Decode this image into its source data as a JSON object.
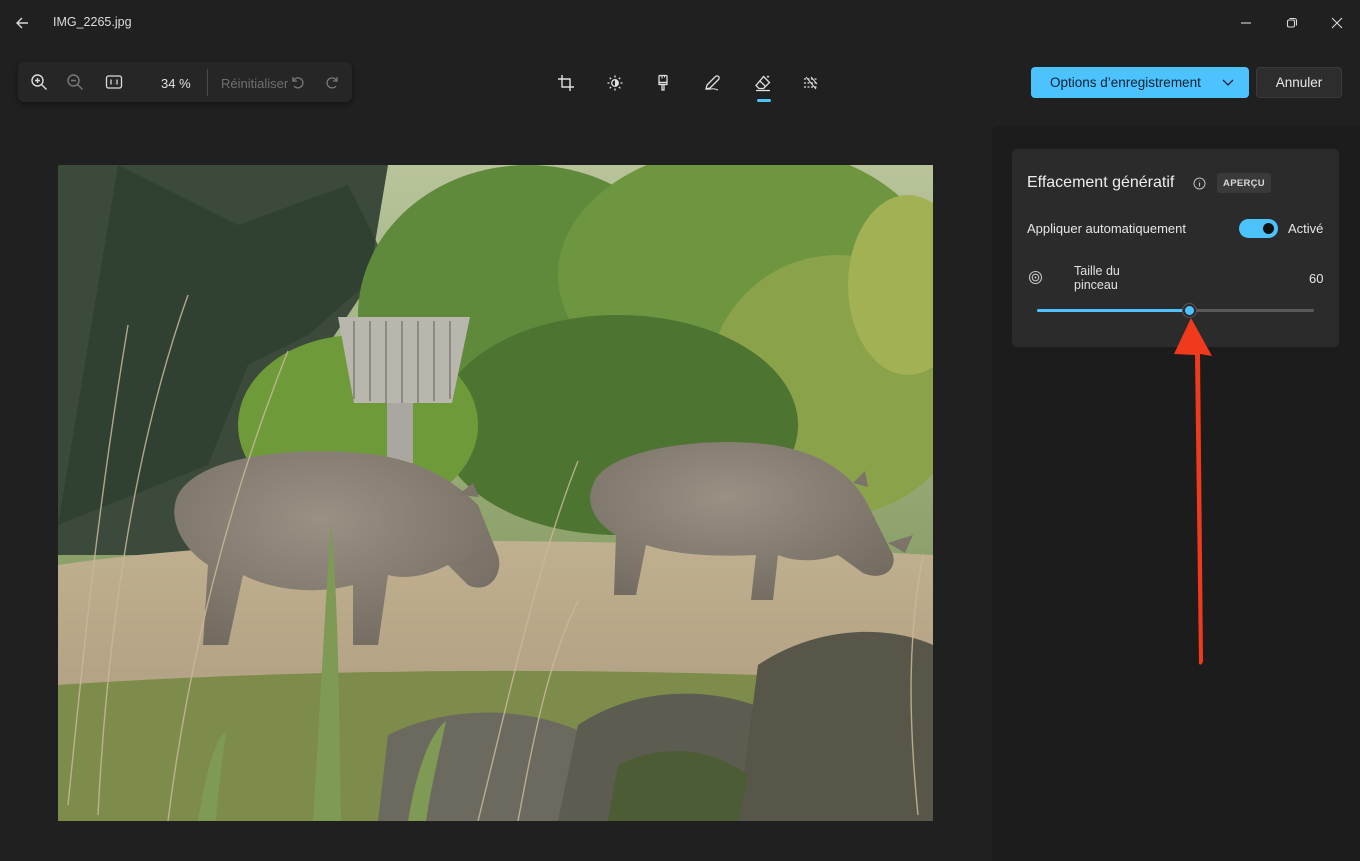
{
  "window": {
    "file_name": "IMG_2265.jpg"
  },
  "zoom_bar": {
    "zoom_percent": "34 %",
    "reset_label": "Réinitialiser"
  },
  "actions": {
    "save_options_label": "Options d’enregistrement",
    "cancel_label": "Annuler"
  },
  "tools": [
    {
      "icon": "crop-icon",
      "active": false
    },
    {
      "icon": "brightness-icon",
      "active": false
    },
    {
      "icon": "filter-icon",
      "active": false
    },
    {
      "icon": "markup-pen-icon",
      "active": false
    },
    {
      "icon": "generative-erase-icon",
      "active": true
    },
    {
      "icon": "background-blur-icon",
      "active": false
    }
  ],
  "panel": {
    "title": "Effacement génératif",
    "badge": "APERÇU",
    "auto_apply_label": "Appliquer automatiquement",
    "auto_apply_state": "Activé",
    "brush_size_label": "Taille du pinceau",
    "brush_size_value": "60",
    "brush_size_fraction": 0.55
  },
  "colors": {
    "accent": "#4cc2ff",
    "annotation_arrow": "#f03a1e",
    "background": "#202020",
    "panel": "#2b2b2b"
  }
}
